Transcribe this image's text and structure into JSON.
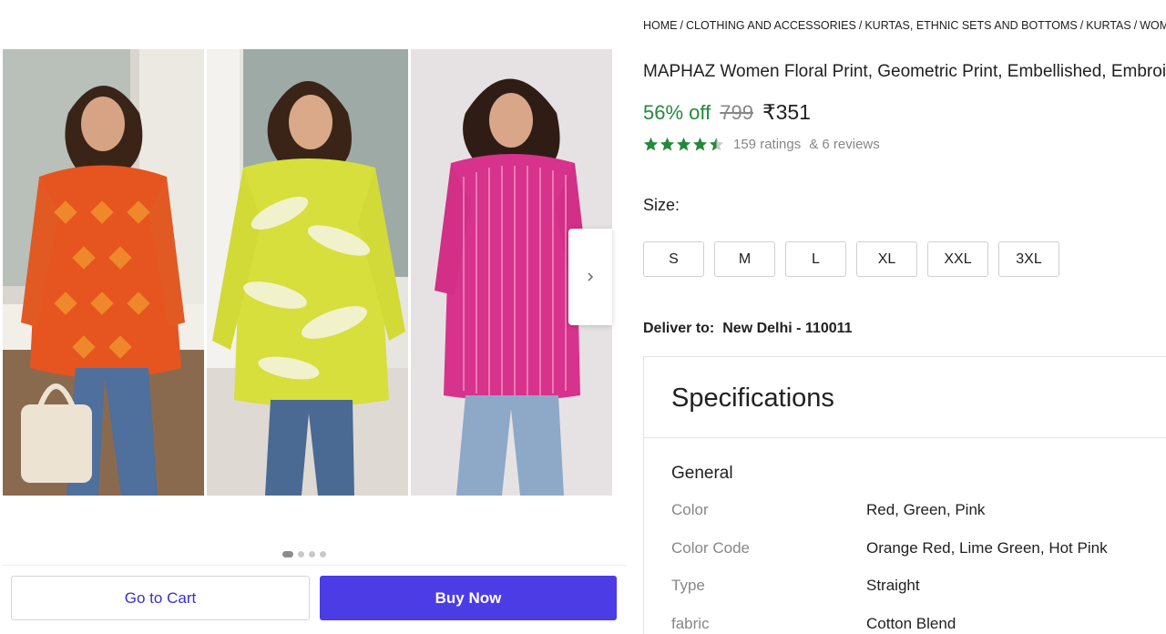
{
  "breadcrumb": [
    "HOME",
    "CLOTHING AND ACCESSORIES",
    "KURTAS, ETHNIC SETS AND BOTTOMS",
    "KURTAS",
    "WOMEN"
  ],
  "breadcrumb_sep": "/",
  "product": {
    "title": "MAPHAZ Women Floral Print, Geometric Print, Embellished, Embroidered Viscose Rayon Straight Kurta",
    "discount": "56% off",
    "mrp": "799",
    "price": "₹351",
    "rating_value": 4.5,
    "ratings": "159 ratings",
    "reviews": "& 6 reviews"
  },
  "colors": {
    "accent": "#4b3ce6",
    "green": "#25893b",
    "star": "#25893b"
  },
  "gallery": {
    "images": [
      {
        "name": "product-image-orange-kurta",
        "color": "#e6541f"
      },
      {
        "name": "product-image-lime-kurta",
        "color": "#d6df3c"
      },
      {
        "name": "product-image-pink-kurta",
        "color": "#d7328c"
      }
    ],
    "next_icon": "chevron-right-icon",
    "dots": 4,
    "active_dot": 1
  },
  "actions": {
    "cart_label": "Go to Cart",
    "buy_label": "Buy Now"
  },
  "size": {
    "label": "Size:",
    "options": [
      "S",
      "M",
      "L",
      "XL",
      "XXL",
      "3XL"
    ]
  },
  "delivery": {
    "label": "Deliver to:",
    "value": "New Delhi - 110011"
  },
  "specs": {
    "title": "Specifications",
    "section": "General",
    "rows": [
      {
        "key": "Color",
        "value": "Red, Green, Pink"
      },
      {
        "key": "Color Code",
        "value": "Orange Red, Lime Green, Hot Pink"
      },
      {
        "key": "Type",
        "value": "Straight"
      },
      {
        "key": "fabric",
        "value": "Cotton Blend"
      }
    ]
  }
}
